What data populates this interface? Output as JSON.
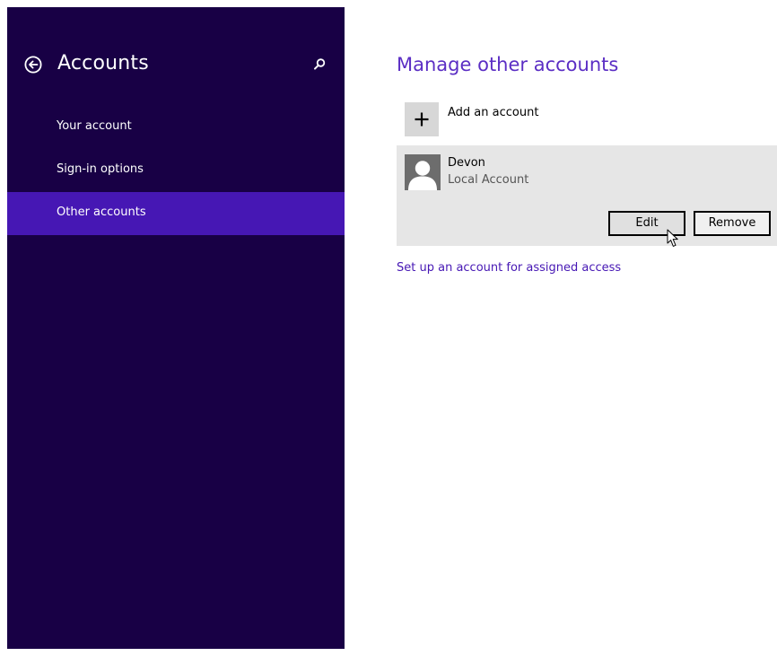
{
  "sidebar": {
    "title": "Accounts",
    "back_icon": "back-arrow-circle-icon",
    "search_icon": "search-icon",
    "items": [
      {
        "label": "Your account",
        "selected": false
      },
      {
        "label": "Sign-in options",
        "selected": false
      },
      {
        "label": "Other accounts",
        "selected": true
      }
    ],
    "background_color": "#180045",
    "selected_color": "#4617b4"
  },
  "main": {
    "title": "Manage other accounts",
    "add_account": {
      "label": "Add an account",
      "icon": "plus-icon"
    },
    "accounts": [
      {
        "name": "Devon",
        "type": "Local Account",
        "avatar_icon": "user-avatar-icon",
        "edit_label": "Edit",
        "remove_label": "Remove"
      }
    ],
    "assigned_access_link": "Set up an account for assigned access",
    "accent_color": "#5b2ec4"
  }
}
